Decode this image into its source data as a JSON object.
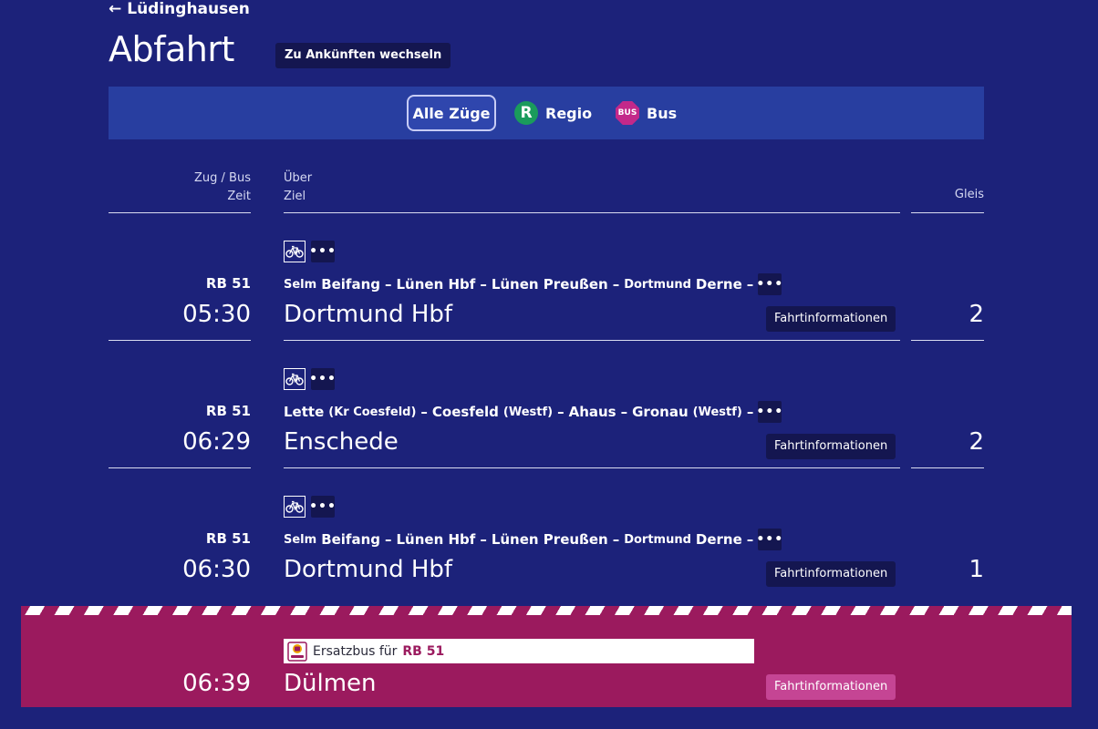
{
  "nav": {
    "back_label": "Lüdinghausen"
  },
  "page": {
    "title": "Abfahrt",
    "switch_label": "Zu Ankünften wechseln"
  },
  "filters": {
    "all_label": "Alle Züge",
    "regio_badge": "R",
    "regio_label": "Regio",
    "bus_badge": "BUS",
    "bus_label": "Bus"
  },
  "headers": {
    "train_bus": "Zug / Bus",
    "time": "Zeit",
    "via": "Über",
    "destination": "Ziel",
    "platform": "Gleis"
  },
  "more_dots": "•••",
  "departures": [
    {
      "train": "RB 51",
      "time": "05:30",
      "via": [
        {
          "t": "Selm",
          "small": true
        },
        {
          "t": "Beifang",
          "small": false
        },
        {
          "t": "–",
          "small": false
        },
        {
          "t": "Lünen Hbf",
          "small": false
        },
        {
          "t": "–",
          "small": false
        },
        {
          "t": "Lünen Preußen",
          "small": false
        },
        {
          "t": "–",
          "small": false
        },
        {
          "t": "Dortmund",
          "small": true
        },
        {
          "t": "Derne",
          "small": false
        },
        {
          "t": "–",
          "small": false
        }
      ],
      "destination": "Dortmund Hbf",
      "info_label": "Fahrtinformationen",
      "platform": "2"
    },
    {
      "train": "RB 51",
      "time": "06:29",
      "via": [
        {
          "t": "Lette",
          "small": false
        },
        {
          "t": "(Kr Coesfeld)",
          "small": true
        },
        {
          "t": "–",
          "small": false
        },
        {
          "t": "Coesfeld",
          "small": false
        },
        {
          "t": "(Westf)",
          "small": true
        },
        {
          "t": "–",
          "small": false
        },
        {
          "t": "Ahaus",
          "small": false
        },
        {
          "t": "–",
          "small": false
        },
        {
          "t": "Gronau",
          "small": false
        },
        {
          "t": "(Westf)",
          "small": true
        },
        {
          "t": "–",
          "small": false
        }
      ],
      "destination": "Enschede",
      "info_label": "Fahrtinformationen",
      "platform": "2"
    },
    {
      "train": "RB 51",
      "time": "06:30",
      "via": [
        {
          "t": "Selm",
          "small": true
        },
        {
          "t": "Beifang",
          "small": false
        },
        {
          "t": "–",
          "small": false
        },
        {
          "t": "Lünen Hbf",
          "small": false
        },
        {
          "t": "–",
          "small": false
        },
        {
          "t": "Lünen Preußen",
          "small": false
        },
        {
          "t": "–",
          "small": false
        },
        {
          "t": "Dortmund",
          "small": true
        },
        {
          "t": "Derne",
          "small": false
        },
        {
          "t": "–",
          "small": false
        }
      ],
      "destination": "Dortmund Hbf",
      "info_label": "Fahrtinformationen",
      "platform": "1"
    }
  ],
  "replacement_bus": {
    "notice_prefix": "Ersatzbus für",
    "notice_train": "RB 51",
    "time": "06:39",
    "destination": "Dülmen",
    "info_label": "Fahrtinformationen"
  },
  "colors": {
    "background": "#1c227a",
    "filter_bar": "#283ea0",
    "button_dark": "#141650",
    "bus_band": "#9b1a5e",
    "regio_green": "#1a9b5c",
    "bus_magenta": "#c3288a"
  }
}
